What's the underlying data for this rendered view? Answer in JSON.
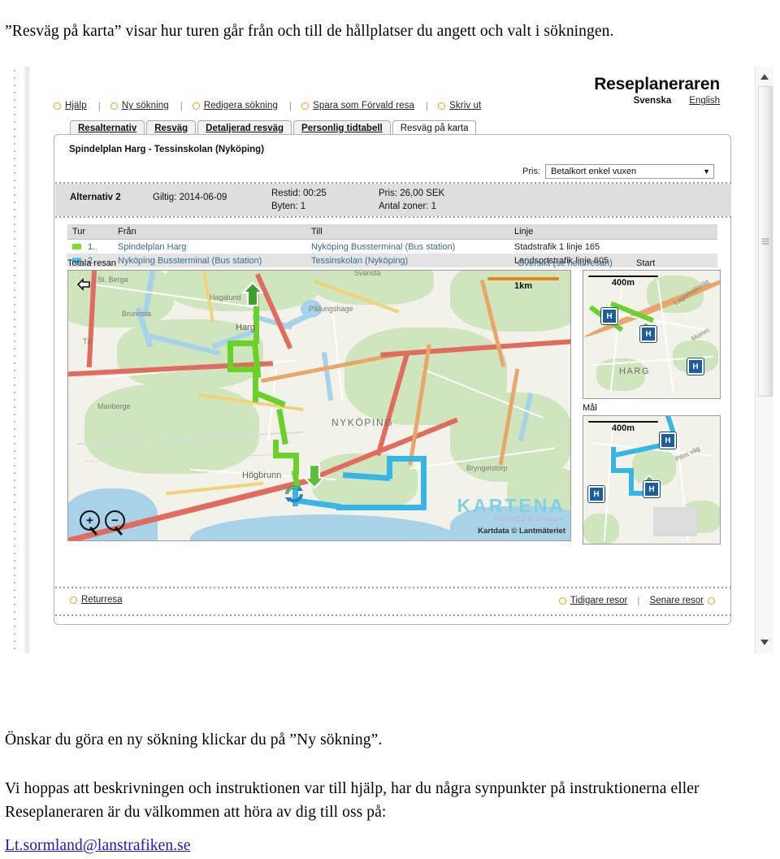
{
  "document": {
    "intro_paragraph": "”Resväg på karta” visar hur turen går från och till de hållplatser du angett och valt i sökningen.",
    "para_new_search": "Önskar du göra en ny sökning klickar du på ”Ny sökning”.",
    "para_feedback": "Vi hoppas att beskrivningen och instruktionen var till hjälp, har du några synpunkter på instruktionerna eller Reseplaneraren är du välkommen att höra av dig till oss på:",
    "email": "Lt.sormland@lanstrafiken.se"
  },
  "screenshot": {
    "toolbar": {
      "links": [
        {
          "label": "Hjälp"
        },
        {
          "label": "Ny sökning"
        },
        {
          "label": "Redigera sökning"
        },
        {
          "label": "Spara som Förvald resa"
        },
        {
          "label": "Skriv ut"
        }
      ],
      "separator": "|"
    },
    "brand": {
      "name": "Reseplaneraren",
      "lang_sv": "Svenska",
      "lang_en": "English"
    },
    "tabs": [
      {
        "label": "Resalternativ",
        "active": false
      },
      {
        "label": "Resväg",
        "active": false
      },
      {
        "label": "Detaljerad resväg",
        "active": false
      },
      {
        "label": "Personlig tidtabell",
        "active": false
      },
      {
        "label": "Resväg på karta",
        "active": true
      }
    ],
    "journey": {
      "title": "Spindelplan Harg - Tessinskolan (Nyköping)",
      "price_label": "Pris:",
      "price_selected": "Betalkort enkel vuxen",
      "summary": {
        "alternative": "Alternativ 2",
        "valid": "Giltig: 2014-06-09",
        "travel_time": "Restid: 00:25",
        "changes": "Byten: 1",
        "price": "Pris: 26,00 SEK",
        "zones": "Antal zoner: 1"
      }
    },
    "legs_table": {
      "headers": [
        "Tur",
        "Från",
        "Till",
        "Linje"
      ],
      "rows": [
        {
          "color": "#7ddd2a",
          "index": "1.",
          "from": "Spindelplan Harg",
          "to": "Nyköping Bussterminal (Bus station)",
          "line": "Stadstrafik 1 linje 165"
        },
        {
          "color": "#4ec3ec",
          "index": "2.",
          "from": "Nyköping Bussterminal (Bus station)",
          "to": "Tessinskolan (Nyköping)",
          "line": "Landsortstrafik linje 605"
        }
      ]
    },
    "map": {
      "main_label": "Totala resan",
      "overview_link": "Översikt (se hela resan)",
      "start_label": "Start",
      "goal_label": "Mål",
      "main_scale": "1km",
      "mini_scale": "400m",
      "attribution_brand": "KARTENA",
      "attribution_sub": "ADDNODE GROUP",
      "attribution_data": "Kartdata © Lantmäteriet",
      "zoom_in": "+",
      "zoom_out": "−",
      "stop_marker": "H",
      "place_labels": [
        "St. Berga",
        "Brunnsta",
        "Tå",
        "Hagalund",
        "Harg",
        "Mariberge",
        "Högbrunn",
        "NYKÖPING",
        "Påljungshage",
        "Svansta",
        "Bryngelstorp",
        "HARG",
        "Lagerhällsväg",
        "Momm",
        "Pilos väg"
      ]
    },
    "footer": {
      "return_trip": "Returresa",
      "earlier": "Tidigare resor",
      "later": "Senare resor",
      "separator": "|"
    },
    "colors": {
      "route_green": "#69d12a",
      "route_blue": "#37b6e6",
      "bullet_orange": "#e8a317",
      "link_blue": "#3a6a8a"
    }
  }
}
